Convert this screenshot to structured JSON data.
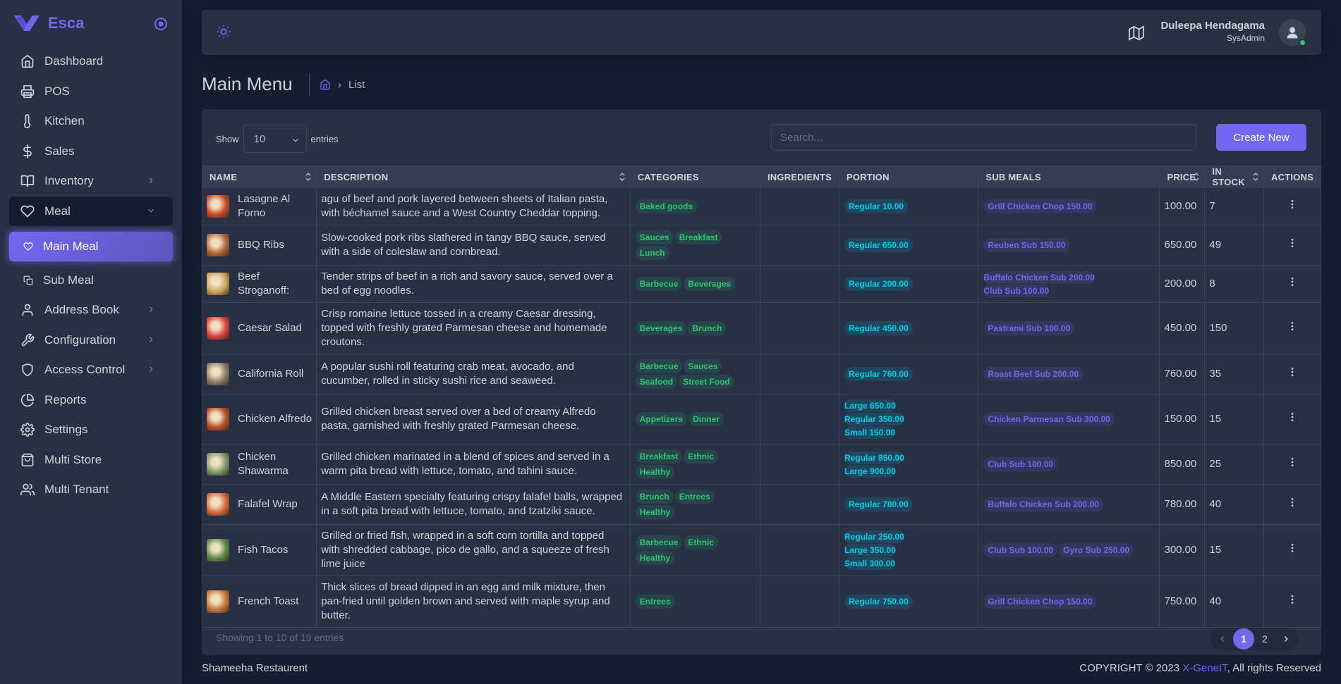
{
  "brand": {
    "name": "Esca"
  },
  "sidebar": {
    "items": [
      {
        "label": "Dashboard",
        "icon": "home-icon"
      },
      {
        "label": "POS",
        "icon": "printer-icon"
      },
      {
        "label": "Kitchen",
        "icon": "thermometer-icon"
      },
      {
        "label": "Sales",
        "icon": "dollar-icon"
      },
      {
        "label": "Inventory",
        "icon": "book-icon"
      },
      {
        "label": "Meal",
        "icon": "heart-icon"
      },
      {
        "label": "Main Meal",
        "icon": "heart-icon"
      },
      {
        "label": "Sub Meal",
        "icon": "copy-icon"
      },
      {
        "label": "Address Book",
        "icon": "user-icon"
      },
      {
        "label": "Configuration",
        "icon": "tool-icon"
      },
      {
        "label": "Access Control",
        "icon": "shield-icon"
      },
      {
        "label": "Reports",
        "icon": "pie-chart-icon"
      },
      {
        "label": "Settings",
        "icon": "settings-icon"
      },
      {
        "label": "Multi Store",
        "icon": "shopping-bag-icon"
      },
      {
        "label": "Multi Tenant",
        "icon": "users-icon"
      }
    ]
  },
  "user": {
    "name": "Duleepa Hendagama",
    "role": "SysAdmin"
  },
  "page": {
    "title": "Main Menu",
    "breadcrumb": "List"
  },
  "controls": {
    "show": "Show",
    "entries_value": "10",
    "entries": "entries",
    "search_placeholder": "Search...",
    "create": "Create New"
  },
  "table": {
    "headers": [
      "NAME",
      "DESCRIPTION",
      "CATEGORIES",
      "INGREDIENTS",
      "PORTION",
      "SUB MEALS",
      "PRICE",
      "IN STOCK",
      "ACTIONS"
    ],
    "rows": [
      {
        "name": "Lasagne Al Forno",
        "desc": "agu of beef and pork layered between sheets of Italian pasta, with béchamel sauce and a West Country Cheddar topping.",
        "cats": [
          "Baked goods"
        ],
        "portions": [
          "Regular 10.00"
        ],
        "subs": [
          "Grill Chicken Chop 150.00"
        ],
        "price": "100.00",
        "stock": "7",
        "thumb": "#c84a2a"
      },
      {
        "name": "BBQ Ribs",
        "desc": "Slow-cooked pork ribs slathered in tangy BBQ sauce, served with a side of coleslaw and cornbread.",
        "cats": [
          "Sauces",
          "Breakfast",
          "Lunch"
        ],
        "portions": [
          "Regular 650.00"
        ],
        "subs": [
          "Reuben Sub 150.00"
        ],
        "price": "650.00",
        "stock": "49",
        "thumb": "#b5653a"
      },
      {
        "name": "Beef Stroganoff:",
        "desc": "Tender strips of beef in a rich and savory sauce, served over a bed of egg noodles.",
        "cats": [
          "Barbecue",
          "Beverages"
        ],
        "portions": [
          "Regular 200.00"
        ],
        "subs": [
          "Buffalo Chicken Sub 200.00",
          "Club Sub 100.00"
        ],
        "price": "200.00",
        "stock": "8",
        "thumb": "#c9a45c"
      },
      {
        "name": "Caesar Salad",
        "desc": "Crisp romaine lettuce tossed in a creamy Caesar dressing, topped with freshly grated Parmesan cheese and homemade croutons.",
        "cats": [
          "Beverages",
          "Brunch"
        ],
        "portions": [
          "Regular 450.00"
        ],
        "subs": [
          "Pastrami Sub 100.00"
        ],
        "price": "450.00",
        "stock": "150",
        "thumb": "#d9433a"
      },
      {
        "name": "California Roll",
        "desc": "A popular sushi roll featuring crab meat, avocado, and cucumber, rolled in sticky sushi rice and seaweed.",
        "cats": [
          "Barbecue",
          "Sauces",
          "Seafood",
          "Street Food"
        ],
        "portions": [
          "Regular 760.00"
        ],
        "subs": [
          "Roast Beef Sub 200.00"
        ],
        "price": "760.00",
        "stock": "35",
        "thumb": "#8a7a6a"
      },
      {
        "name": "Chicken Alfredo",
        "desc": "Grilled chicken breast served over a bed of creamy Alfredo pasta, garnished with freshly grated Parmesan cheese.",
        "cats": [
          "Appetizers",
          "Dinner"
        ],
        "portions": [
          "Large 650.00",
          "Regular 350.00",
          "Small 150.00"
        ],
        "subs": [
          "Chicken Parmesan Sub 300.00"
        ],
        "price": "150.00",
        "stock": "15",
        "thumb": "#b8502a"
      },
      {
        "name": "Chicken Shawarma",
        "desc": "Grilled chicken marinated in a blend of spices and served in a warm pita bread with lettuce, tomato, and tahini sauce.",
        "cats": [
          "Breakfast",
          "Ethnic",
          "Healthy"
        ],
        "portions": [
          "Regular 850.00",
          "Large 900.00"
        ],
        "subs": [
          "Club Sub 100.00"
        ],
        "price": "850.00",
        "stock": "25",
        "thumb": "#7e9a6a"
      },
      {
        "name": "Falafel Wrap",
        "desc": "A Middle Eastern specialty featuring crispy falafel balls, wrapped in a soft pita bread with lettuce, tomato, and tzatziki sauce.",
        "cats": [
          "Brunch",
          "Entrees",
          "Healthy"
        ],
        "portions": [
          "Regular 780.00"
        ],
        "subs": [
          "Buffalo Chicken Sub 200.00"
        ],
        "price": "780.00",
        "stock": "40",
        "thumb": "#d8683a"
      },
      {
        "name": "Fish Tacos",
        "desc": "Grilled or fried fish, wrapped in a soft corn tortilla and topped with shredded cabbage, pico de gallo, and a squeeze of fresh lime juice",
        "cats": [
          "Barbecue",
          "Ethnic",
          "Healthy"
        ],
        "portions": [
          "Regular 250.00",
          "Large 350.00",
          "Small 300.00"
        ],
        "subs": [
          "Club Sub 100.00",
          "Gyro Sub 250.00"
        ],
        "price": "300.00",
        "stock": "15",
        "thumb": "#5a8a4a"
      },
      {
        "name": "French Toast",
        "desc": "Thick slices of bread dipped in an egg and milk mixture, then pan-fried until golden brown and served with maple syrup and butter.",
        "cats": [
          "Entrees"
        ],
        "portions": [
          "Regular 750.00"
        ],
        "subs": [
          "Grill Chicken Chop 150.00"
        ],
        "price": "750.00",
        "stock": "40",
        "thumb": "#c8763a"
      }
    ]
  },
  "pagination": {
    "summary": "Showing 1 to 10 of 19 entries",
    "pages": [
      "1",
      "2"
    ]
  },
  "footer": {
    "left": "Shameeha Restaurent",
    "copyright": "COPYRIGHT © 2023",
    "company": "X-GeneIT",
    "rights": ", All rights Reserved"
  },
  "colors": {
    "primary": "#7367f0",
    "success": "#28c76f",
    "info": "#00cfe8",
    "bg": "#161d31",
    "card": "#283046"
  }
}
